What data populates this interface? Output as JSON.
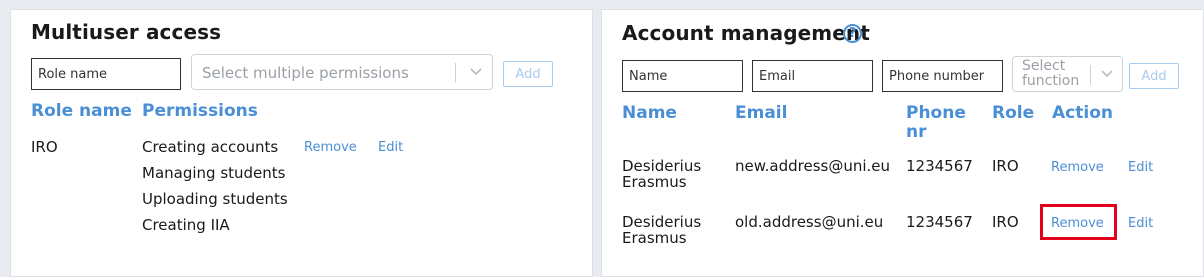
{
  "multiuser": {
    "title": "Multiuser access",
    "role_name_placeholder": "Role name",
    "permissions_placeholder": "Select multiple permissions",
    "add_label": "Add",
    "headers": {
      "role_name": "Role name",
      "permissions": "Permissions"
    },
    "rows": [
      {
        "role": "IRO",
        "permissions": [
          "Creating accounts",
          "Managing students",
          "Uploading students",
          "Creating IIA"
        ],
        "remove_label": "Remove",
        "edit_label": "Edit"
      }
    ]
  },
  "account": {
    "title": "Account management",
    "name_placeholder": "Name",
    "email_placeholder": "Email",
    "phone_placeholder": "Phone number",
    "function_placeholder_line1": "Select",
    "function_placeholder_line2": "function",
    "add_label": "Add",
    "headers": {
      "name": "Name",
      "email": "Email",
      "phone_line1": "Phone",
      "phone_line2": "nr",
      "role": "Role",
      "action": "Action"
    },
    "rows": [
      {
        "name_line1": "Desiderius",
        "name_line2": "Erasmus",
        "email": "new.address@uni.eu",
        "phone": "1234567",
        "role": "IRO",
        "remove_label": "Remove",
        "edit_label": "Edit"
      },
      {
        "name_line1": "Desiderius",
        "name_line2": "Erasmus",
        "email": "old.address@uni.eu",
        "phone": "1234567",
        "role": "IRO",
        "remove_label": "Remove",
        "edit_label": "Edit"
      }
    ]
  },
  "colors": {
    "accent": "#4a8fd6",
    "highlight": "#e3001b"
  }
}
